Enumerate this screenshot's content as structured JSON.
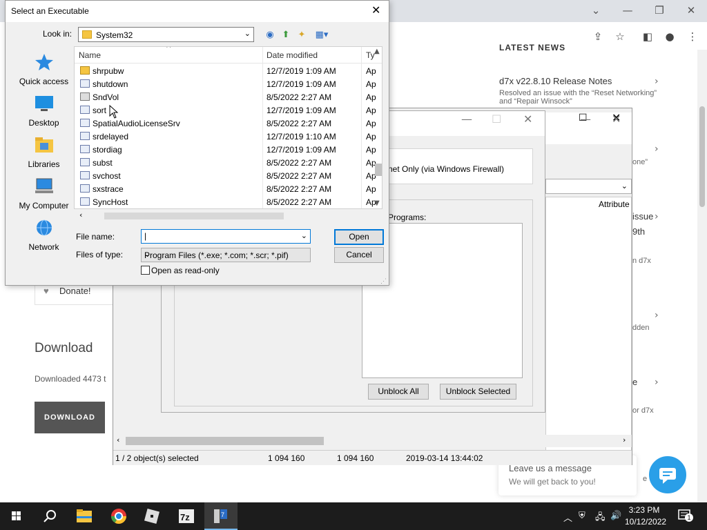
{
  "browser": {
    "controls": {
      "tabs_menu": "⌄",
      "minimize": "—",
      "restore": "❐",
      "close": "✕"
    }
  },
  "website": {
    "news_heading": "LATEST NEWS",
    "news": [
      {
        "title": "d7x v22.8.10 Release Notes",
        "desc": "Resolved an issue with the “Reset Networking” and “Repair Winsock”"
      }
    ],
    "fragments": [
      "one”",
      "issue",
      "9th",
      "n d7x",
      "dden",
      "e",
      "or d7x",
      "e th"
    ],
    "donate": "Donate!",
    "download_title": "Download",
    "download_count": "Downloaded 4473 t",
    "download_button": "DOWNLOAD",
    "chat_line1": "Leave us a message",
    "chat_line2": "We will get back to you!"
  },
  "d7x_window": {
    "firewall_option": "net Only (via Windows Firewall)",
    "column_attribute": "Attribute",
    "programs_label": "Programs:",
    "unblock_all": "Unblock All",
    "unblock_selected": "Unblock Selected",
    "status": [
      "1 / 2 object(s) selected",
      "1 094 160",
      "1 094 160",
      "2019-03-14 13:44:02"
    ]
  },
  "dialog": {
    "title": "Select an Executable",
    "look_in_label": "Look in:",
    "look_in_value": "System32",
    "places": [
      "Quick access",
      "Desktop",
      "Libraries",
      "My Computer",
      "Network"
    ],
    "columns": {
      "name": "Name",
      "date": "Date modified",
      "type": "Ty"
    },
    "files": [
      {
        "name": "shrpubw",
        "date": "12/7/2019 1:09 AM",
        "type": "Ap"
      },
      {
        "name": "shutdown",
        "date": "12/7/2019 1:09 AM",
        "type": "Ap"
      },
      {
        "name": "SndVol",
        "date": "8/5/2022 2:27 AM",
        "type": "Ap"
      },
      {
        "name": "sort",
        "date": "12/7/2019 1:09 AM",
        "type": "Ap"
      },
      {
        "name": "SpatialAudioLicenseSrv",
        "date": "8/5/2022 2:27 AM",
        "type": "Ap"
      },
      {
        "name": "srdelayed",
        "date": "12/7/2019 1:10 AM",
        "type": "Ap"
      },
      {
        "name": "stordiag",
        "date": "12/7/2019 1:09 AM",
        "type": "Ap"
      },
      {
        "name": "subst",
        "date": "8/5/2022 2:27 AM",
        "type": "Ap"
      },
      {
        "name": "svchost",
        "date": "8/5/2022 2:27 AM",
        "type": "Ap"
      },
      {
        "name": "sxstrace",
        "date": "8/5/2022 2:27 AM",
        "type": "Ap"
      },
      {
        "name": "SyncHost",
        "date": "8/5/2022 2:27 AM",
        "type": "Ap"
      }
    ],
    "file_name_label": "File name:",
    "file_name_value": "",
    "files_of_type_label": "Files of type:",
    "files_of_type_value": "Program Files (*.exe; *.com; *.scr; *.pif)",
    "read_only_label": "Open as read-only",
    "open_button": "Open",
    "cancel_button": "Cancel"
  },
  "taskbar": {
    "time": "3:23 PM",
    "date": "10/12/2022",
    "notification_count": "1"
  }
}
